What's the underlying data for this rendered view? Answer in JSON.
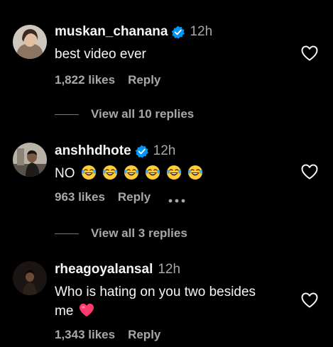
{
  "comments": [
    {
      "username": "muskan_chanana",
      "verified": true,
      "time": "12h",
      "text": "best video ever",
      "likes": "1,822 likes",
      "reply": "Reply",
      "view_replies": "View all 10 replies"
    },
    {
      "username": "anshhdhote",
      "verified": true,
      "time": "12h",
      "text": "NO",
      "emojis": [
        "laughing-emoji",
        "laughing-emoji",
        "laughing-emoji",
        "laughing-emoji",
        "laughing-emoji",
        "laughing-emoji"
      ],
      "likes": "963 likes",
      "reply": "Reply",
      "view_replies": "View all 3 replies"
    },
    {
      "username": "rheagoyalansal",
      "verified": false,
      "time": "12h",
      "text_line1": "Who is hating on you two besides",
      "text_line2": "me",
      "likes": "1,343 likes",
      "reply": "Reply"
    }
  ],
  "colors": {
    "background": "#000000",
    "primary_text": "#f5f5f5",
    "secondary_text": "#a8a8a8",
    "verified_badge": "#0095f6",
    "heart_emoji": "#ff3b6b"
  }
}
